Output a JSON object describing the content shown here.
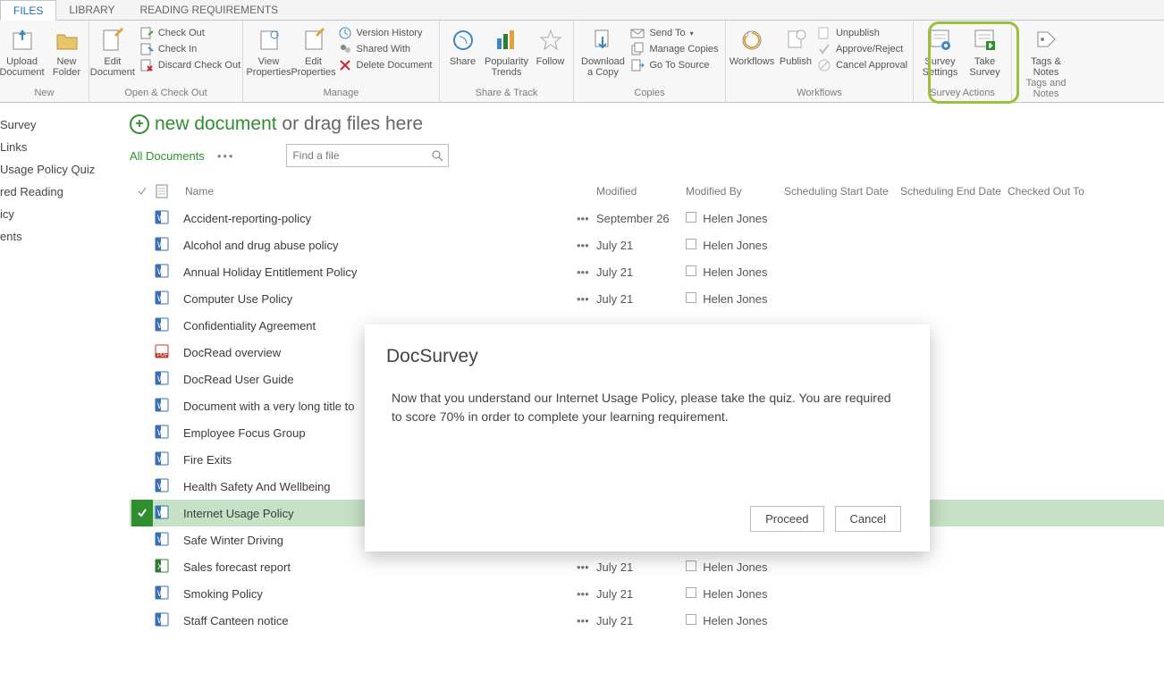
{
  "tabs": {
    "files": "FILES",
    "library": "LIBRARY",
    "reading": "READING REQUIREMENTS"
  },
  "ribbon": {
    "new_group": "New",
    "upload": "Upload Document",
    "new_folder": "New Folder",
    "openclose_group": "Open & Check Out",
    "edit_doc": "Edit Document",
    "check_out": "Check Out",
    "check_in": "Check In",
    "discard": "Discard Check Out",
    "manage_group": "Manage",
    "view_props": "View Properties",
    "edit_props": "Edit Properties",
    "version_history": "Version History",
    "shared_with": "Shared With",
    "delete_doc": "Delete Document",
    "sharetrack_group": "Share & Track",
    "share": "Share",
    "popularity": "Popularity Trends",
    "follow": "Follow",
    "copies_group": "Copies",
    "download_copy": "Download a Copy",
    "send_to": "Send To",
    "manage_copies": "Manage Copies",
    "goto_source": "Go To Source",
    "workflows_group": "Workflows",
    "workflows": "Workflows",
    "publish": "Publish",
    "unpublish": "Unpublish",
    "approve_reject": "Approve/Reject",
    "cancel_approval": "Cancel Approval",
    "survey_group": "Survey Actions",
    "survey_settings": "Survey Settings",
    "take_survey": "Take Survey",
    "tags_group": "Tags and Notes",
    "tags_notes": "Tags & Notes"
  },
  "leftnav": [
    "Survey",
    "Links",
    "Usage Policy Quiz",
    "red Reading",
    "icy",
    "ents"
  ],
  "newdoc": {
    "link": "new document",
    "rest": " or drag files here"
  },
  "views": {
    "all": "All Documents"
  },
  "search": {
    "placeholder": "Find a file"
  },
  "columns": {
    "name": "Name",
    "modified": "Modified",
    "modified_by": "Modified By",
    "start": "Scheduling Start Date",
    "end": "Scheduling End Date",
    "checked": "Checked Out To"
  },
  "rows": [
    {
      "icon": "word",
      "name": "Accident-reporting-policy",
      "modified": "September 26",
      "by": "Helen Jones"
    },
    {
      "icon": "word",
      "name": "Alcohol and drug abuse policy",
      "modified": "July 21",
      "by": "Helen Jones"
    },
    {
      "icon": "word",
      "name": "Annual Holiday Entitlement Policy",
      "modified": "July 21",
      "by": "Helen Jones"
    },
    {
      "icon": "word",
      "name": "Computer Use Policy",
      "modified": "July 21",
      "by": "Helen Jones"
    },
    {
      "icon": "word",
      "name": "Confidentiality Agreement",
      "modified": "",
      "by": ""
    },
    {
      "icon": "pdf",
      "name": "DocRead overview",
      "modified": "",
      "by": ""
    },
    {
      "icon": "word",
      "name": "DocRead User Guide",
      "modified": "",
      "by": ""
    },
    {
      "icon": "word",
      "name": "Document with a very long title to",
      "modified": "",
      "by": ""
    },
    {
      "icon": "word",
      "name": "Employee Focus Group",
      "modified": "",
      "by": ""
    },
    {
      "icon": "word",
      "name": "Fire Exits",
      "modified": "",
      "by": ""
    },
    {
      "icon": "word",
      "name": "Health Safety And Wellbeing",
      "modified": "",
      "by": ""
    },
    {
      "icon": "word",
      "name": "Internet Usage Policy",
      "modified": "",
      "by": "",
      "selected": true
    },
    {
      "icon": "word",
      "name": "Safe Winter Driving",
      "modified": "",
      "by": ""
    },
    {
      "icon": "excel",
      "name": "Sales forecast report",
      "modified": "July 21",
      "by": "Helen Jones"
    },
    {
      "icon": "word",
      "name": "Smoking Policy",
      "modified": "July 21",
      "by": "Helen Jones"
    },
    {
      "icon": "word",
      "name": "Staff Canteen notice",
      "modified": "July 21",
      "by": "Helen Jones"
    }
  ],
  "modal": {
    "title": "DocSurvey",
    "body": "Now that you understand our Internet Usage Policy, please take the quiz. You are required to score 70% in order to complete your learning requirement.",
    "proceed": "Proceed",
    "cancel": "Cancel"
  }
}
